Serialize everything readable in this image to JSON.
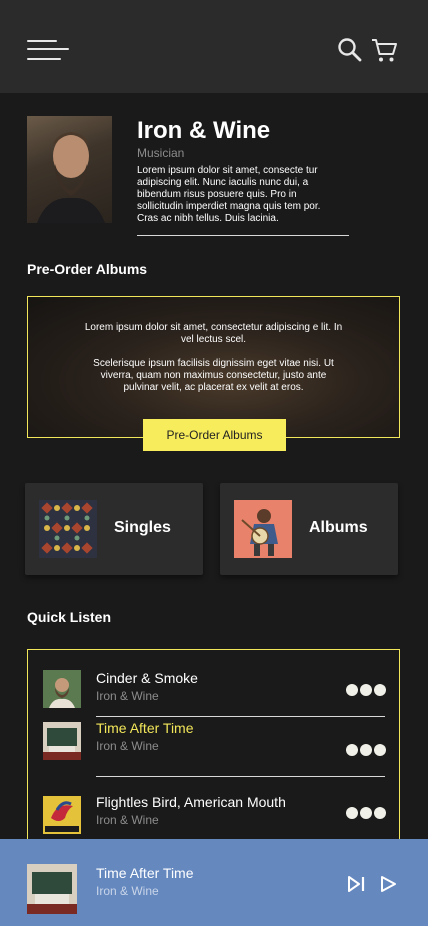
{
  "header": {
    "menu_icon": "hamburger-menu-icon",
    "search_icon": "search-icon",
    "cart_icon": "shopping-cart-icon"
  },
  "artist": {
    "name": "Iron & Wine",
    "role": "Musician",
    "bio": "Lorem ipsum dolor sit amet, consecte tur adipiscing elit. Nunc iaculis nunc dui, a bibendum risus posuere quis. Pro in sollicitudin imperdiet magna quis tem por. Cras ac nibh tellus. Duis lacinia."
  },
  "preorder": {
    "section_title": "Pre-Order Albums",
    "text_1": "Lorem ipsum dolor sit amet, consectetur adipiscing e lit. In vel lectus scel.",
    "text_2": "Scelerisque ipsum facilisis dignissim eget vitae nisi. Ut viverra, quam non maximus consectetur, justo ante pulvinar velit, ac placerat ex velit at eros.",
    "button_label": "Pre-Order Albums"
  },
  "categories": [
    {
      "label": "Singles"
    },
    {
      "label": "Albums"
    }
  ],
  "quick_listen": {
    "section_title": "Quick Listen",
    "tracks": [
      {
        "title": "Cinder & Smoke",
        "artist": "Iron & Wine",
        "active": false
      },
      {
        "title": "Time After Time",
        "artist": "Iron & Wine",
        "active": true
      },
      {
        "title": "Flightles Bird, American Mouth",
        "artist": "Iron & Wine",
        "active": false
      }
    ]
  },
  "now_playing": {
    "title": "Time After Time",
    "artist": "Iron & Wine",
    "next_icon": "skip-next-icon",
    "play_icon": "play-icon"
  },
  "colors": {
    "background": "#1a1a1a",
    "topbar": "#2b2b2b",
    "accent_yellow": "#f2e65a",
    "now_playing_bar": "#6588bf",
    "muted_text": "#8c8c8c"
  }
}
